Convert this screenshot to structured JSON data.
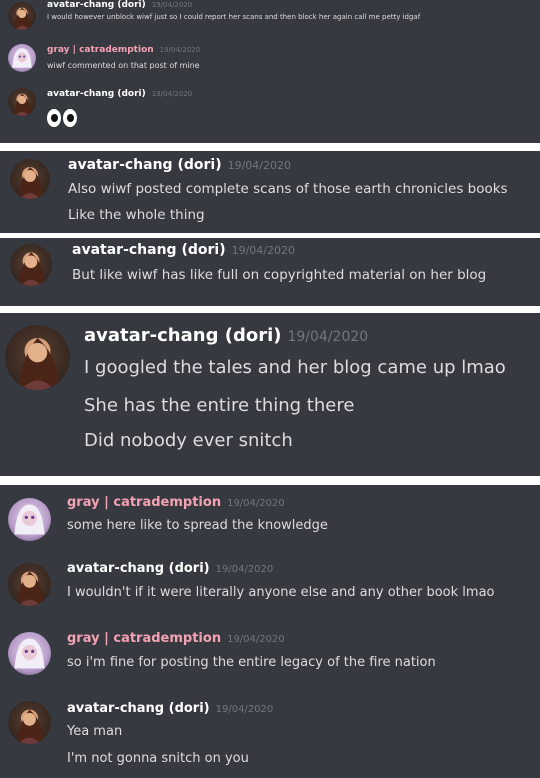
{
  "users": {
    "avatar": "avatar-chang (dori)",
    "gray": "gray | catrademption"
  },
  "date": "19/04/2020",
  "colors": {
    "background": "#36393f",
    "text": "#dcddde",
    "timestamp": "#72767d",
    "gray_name": "#f4a2b4",
    "separator": "#ffffff"
  },
  "panel1": {
    "msg1": {
      "line1": "I would however unblock wiwf just so I could report her scans and then block her again call me petty idgaf"
    },
    "msg2": {
      "line1": "wiwf commented on that post of mine"
    },
    "msg3": {
      "emoji": "eyes-emoji"
    }
  },
  "panel2": {
    "line1": "Also wiwf posted complete scans of those earth chronicles books",
    "line2": "Like the whole thing"
  },
  "panel3": {
    "line1": "But like wiwf has like full on copyrighted material on her blog"
  },
  "panel4": {
    "line1": "I googled the tales and her blog came up lmao",
    "line2": "She has the entire thing there",
    "line3": "Did nobody ever snitch"
  },
  "panel5": {
    "msg1": {
      "line1": "some here like to spread the knowledge"
    },
    "msg2": {
      "line1": "I wouldn't if it were literally anyone else and any other book lmao"
    },
    "msg3": {
      "line1": "so i'm fine for posting the entire legacy of the fire nation"
    },
    "msg4": {
      "line1": "Yea man",
      "line2": "I'm not gonna snitch on you"
    }
  }
}
